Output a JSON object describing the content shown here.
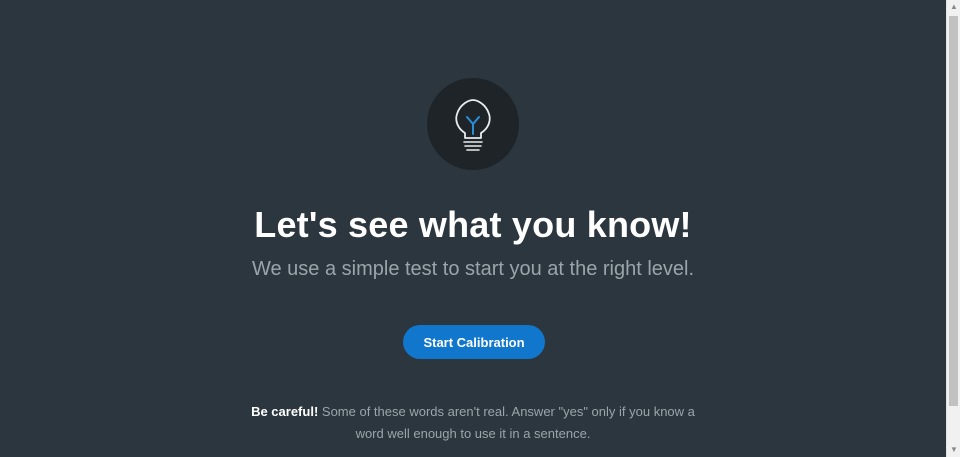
{
  "hero": {
    "icon": "lightbulb-icon",
    "title": "Let's see what you know!",
    "subtitle": "We use a simple test to start you at the right level."
  },
  "actions": {
    "start_label": "Start Calibration"
  },
  "note": {
    "emphasis": "Be careful!",
    "text": " Some of these words aren't real. Answer \"yes\" only if you know a word well enough to use it in a sentence."
  },
  "colors": {
    "background": "#2b363e",
    "icon_circle": "#1e2428",
    "accent": "#1177cc",
    "filament": "#2a8fd6",
    "muted_text": "#9aa5ab"
  }
}
